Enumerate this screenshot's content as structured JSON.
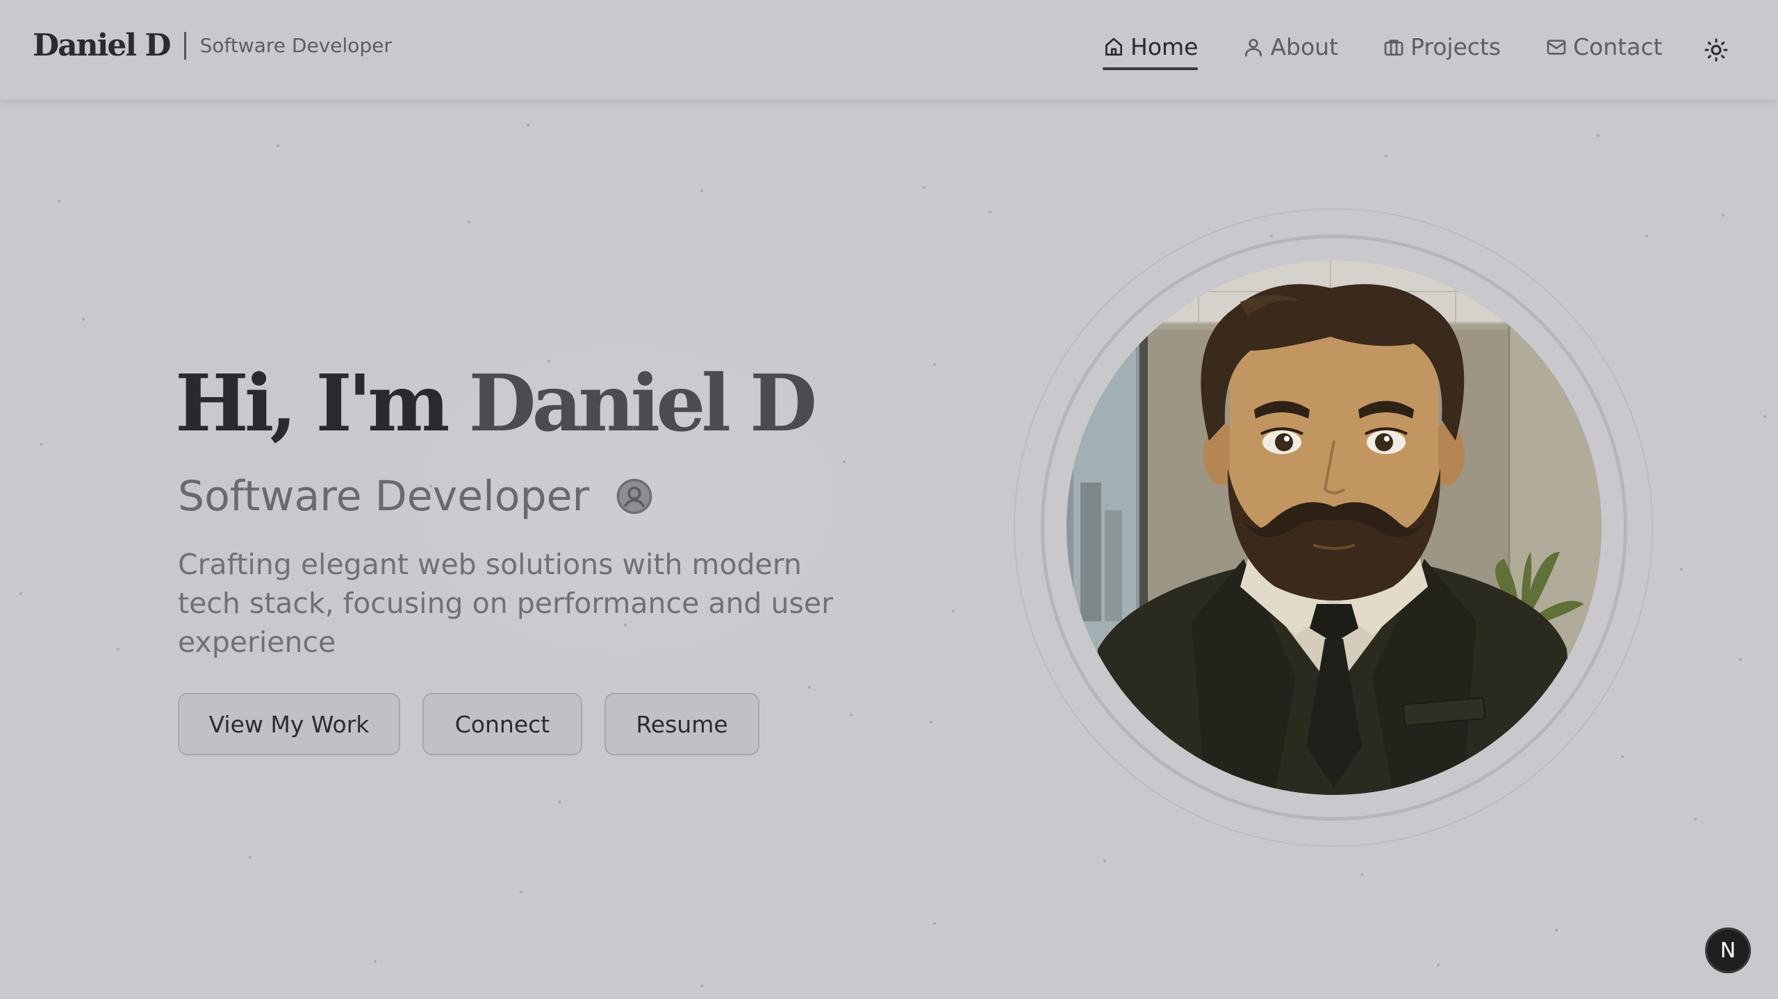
{
  "header": {
    "brand_name": "Daniel D",
    "brand_role": "Software Developer"
  },
  "nav": {
    "items": [
      {
        "label": "Home",
        "icon": "home-icon",
        "active": true
      },
      {
        "label": "About",
        "icon": "user-icon",
        "active": false
      },
      {
        "label": "Projects",
        "icon": "briefcase-icon",
        "active": false
      },
      {
        "label": "Contact",
        "icon": "mail-icon",
        "active": false
      }
    ],
    "theme_toggle_icon": "sun-icon"
  },
  "hero": {
    "greeting": "Hi, I'm",
    "name": "Daniel D",
    "subtitle": "Software Developer",
    "subtitle_icon": "user-circle-icon",
    "description": "Crafting elegant web solutions with modern tech stack, focusing on performance and user experience",
    "buttons": {
      "work": "View My Work",
      "connect": "Connect",
      "resume": "Resume"
    }
  },
  "portrait": {
    "alt": "Illustrated portrait of a bearded man in a dark suit"
  },
  "badge": {
    "label": "N"
  },
  "colors": {
    "background": "#c9c8cd",
    "text_primary": "#2a2a2e",
    "text_secondary": "#6a696e",
    "badge_bg": "#1f1f22"
  }
}
